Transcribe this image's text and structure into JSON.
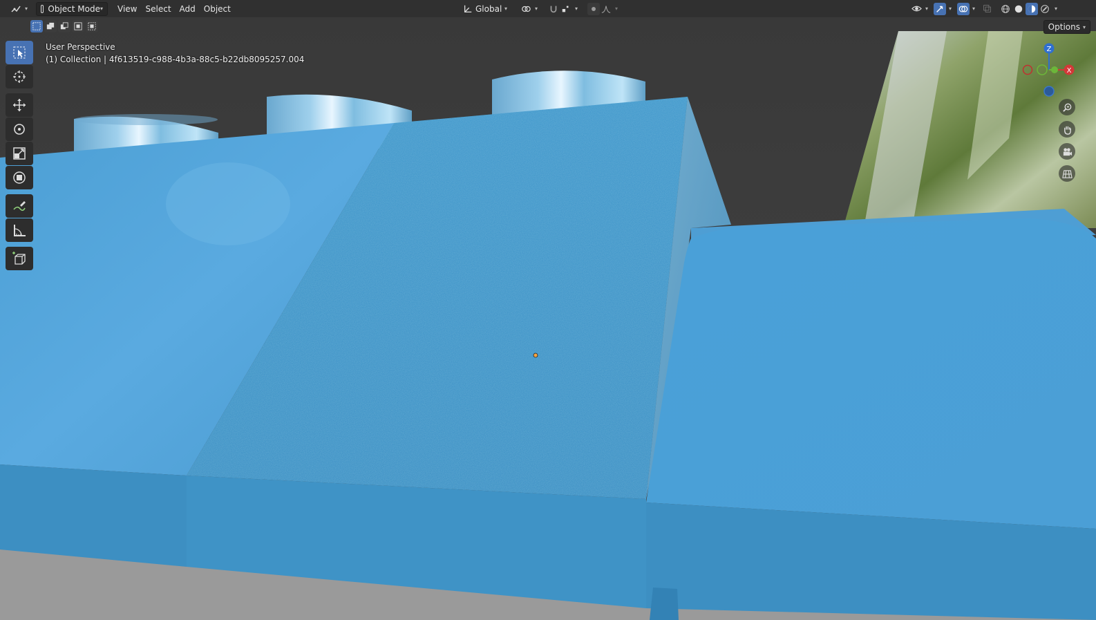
{
  "header": {
    "mode": "Object Mode",
    "menus": [
      "View",
      "Select",
      "Add",
      "Object"
    ],
    "transform_orientation": "Global"
  },
  "viewport": {
    "view_name": "User Perspective",
    "collection_info": "(1) Collection | 4f613519-c988-4b3a-88c5-b22db8095257.004",
    "options_label": "Options"
  },
  "gizmo": {
    "z_label": "Z",
    "x_label": "X"
  },
  "colors": {
    "accent": "#4772b3",
    "object_blue": "#4a9fd4",
    "header_bg": "#303030"
  },
  "icons": [
    "editor-type-icon",
    "object-mode-icon",
    "orientation-icon",
    "pivot-icon",
    "snap-icon",
    "proportional-icon",
    "visibility-icon",
    "gizmo-icon",
    "overlay-icon",
    "xray-icon",
    "wireframe-shading-icon",
    "solid-shading-icon",
    "material-shading-icon",
    "rendered-shading-icon"
  ]
}
